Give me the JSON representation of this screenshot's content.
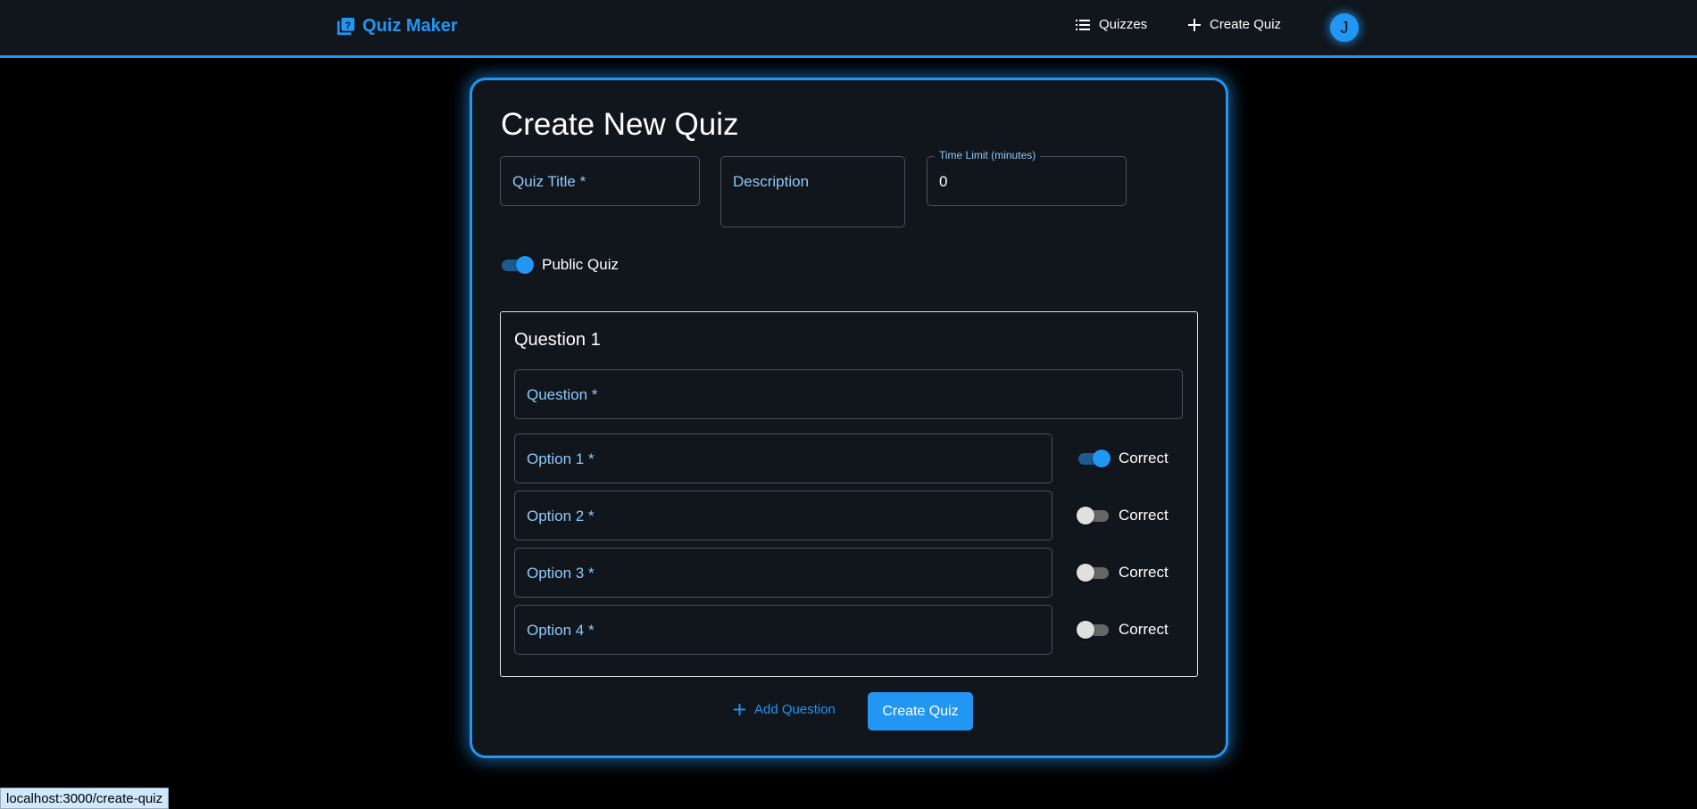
{
  "header": {
    "brand": "Quiz Maker",
    "nav": [
      {
        "label": "Quizzes",
        "icon": "list-icon"
      },
      {
        "label": "Create Quiz",
        "icon": "plus-icon"
      }
    ],
    "avatar_initial": "J"
  },
  "form": {
    "title": "Create New Quiz",
    "quiz_title_label": "Quiz Title *",
    "description_label": "Description",
    "time_limit_label": "Time Limit (minutes)",
    "time_limit_value": "0",
    "public_label": "Public Quiz",
    "public_on": true
  },
  "question": {
    "heading": "Question 1",
    "question_label": "Question *",
    "options": [
      {
        "label": "Option 1 *",
        "correct_label": "Correct",
        "correct": true
      },
      {
        "label": "Option 2 *",
        "correct_label": "Correct",
        "correct": false
      },
      {
        "label": "Option 3 *",
        "correct_label": "Correct",
        "correct": false
      },
      {
        "label": "Option 4 *",
        "correct_label": "Correct",
        "correct": false
      }
    ]
  },
  "actions": {
    "add_question": "Add Question",
    "create_quiz": "Create Quiz"
  },
  "status_url": "localhost:3000/create-quiz",
  "colors": {
    "accent": "#2196f3",
    "label": "#90caf9",
    "surface": "#11151c"
  }
}
